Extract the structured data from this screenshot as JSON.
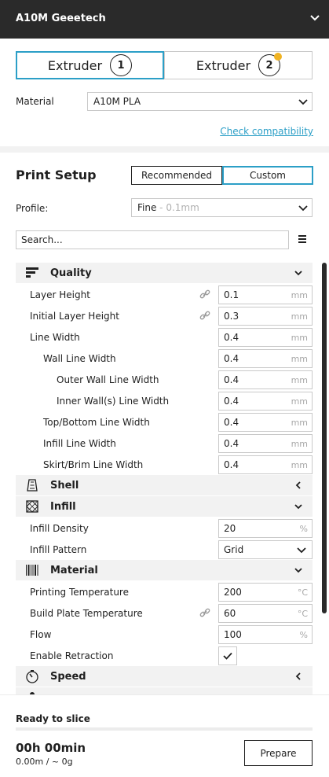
{
  "header": {
    "title": "A10M Geeetech"
  },
  "extruders": [
    {
      "label": "Extruder",
      "number": "1",
      "active": true
    },
    {
      "label": "Extruder",
      "number": "2",
      "active": false
    }
  ],
  "material": {
    "label": "Material",
    "value": "A10M PLA",
    "link": "Check compatibility"
  },
  "print_setup": {
    "title": "Print Setup",
    "modes": [
      "Recommended",
      "Custom"
    ],
    "active_mode": "Custom",
    "profile_label": "Profile:",
    "profile_value": "Fine",
    "profile_detail": " - 0.1mm",
    "search_placeholder": "Search..."
  },
  "settings": {
    "quality": {
      "name": "Quality",
      "rows": [
        {
          "label": "Layer Height",
          "value": "0.1",
          "unit": "mm"
        },
        {
          "label": "Initial Layer Height",
          "value": "0.3",
          "unit": "mm"
        },
        {
          "label": "Line Width",
          "value": "0.4",
          "unit": "mm"
        },
        {
          "label": "Wall Line Width",
          "value": "0.4",
          "unit": "mm"
        },
        {
          "label": "Outer Wall Line Width",
          "value": "0.4",
          "unit": "mm"
        },
        {
          "label": "Inner Wall(s) Line Width",
          "value": "0.4",
          "unit": "mm"
        },
        {
          "label": "Top/Bottom Line Width",
          "value": "0.4",
          "unit": "mm"
        },
        {
          "label": "Infill Line Width",
          "value": "0.4",
          "unit": "mm"
        },
        {
          "label": "Skirt/Brim Line Width",
          "value": "0.4",
          "unit": "mm"
        }
      ]
    },
    "shell": {
      "name": "Shell"
    },
    "infill": {
      "name": "Infill",
      "density_label": "Infill Density",
      "density_value": "20",
      "density_unit": "%",
      "pattern_label": "Infill Pattern",
      "pattern_value": "Grid"
    },
    "material": {
      "name": "Material",
      "rows": [
        {
          "label": "Printing Temperature",
          "value": "200",
          "unit": "°C"
        },
        {
          "label": "Build Plate Temperature",
          "value": "60",
          "unit": "°C"
        },
        {
          "label": "Flow",
          "value": "100",
          "unit": "%"
        }
      ],
      "retraction_label": "Enable Retraction",
      "retraction_checked": true
    },
    "speed": {
      "name": "Speed"
    }
  },
  "footer": {
    "status": "Ready to slice",
    "time": "00h 00min",
    "material_usage": "0.00m / ~ 0g",
    "prepare_label": "Prepare"
  },
  "colors": {
    "accent": "#2c9fc7",
    "header_bg": "#2a2a2a",
    "category_bg": "#f2f2f2",
    "extruder2_dot": "#f0b323"
  }
}
